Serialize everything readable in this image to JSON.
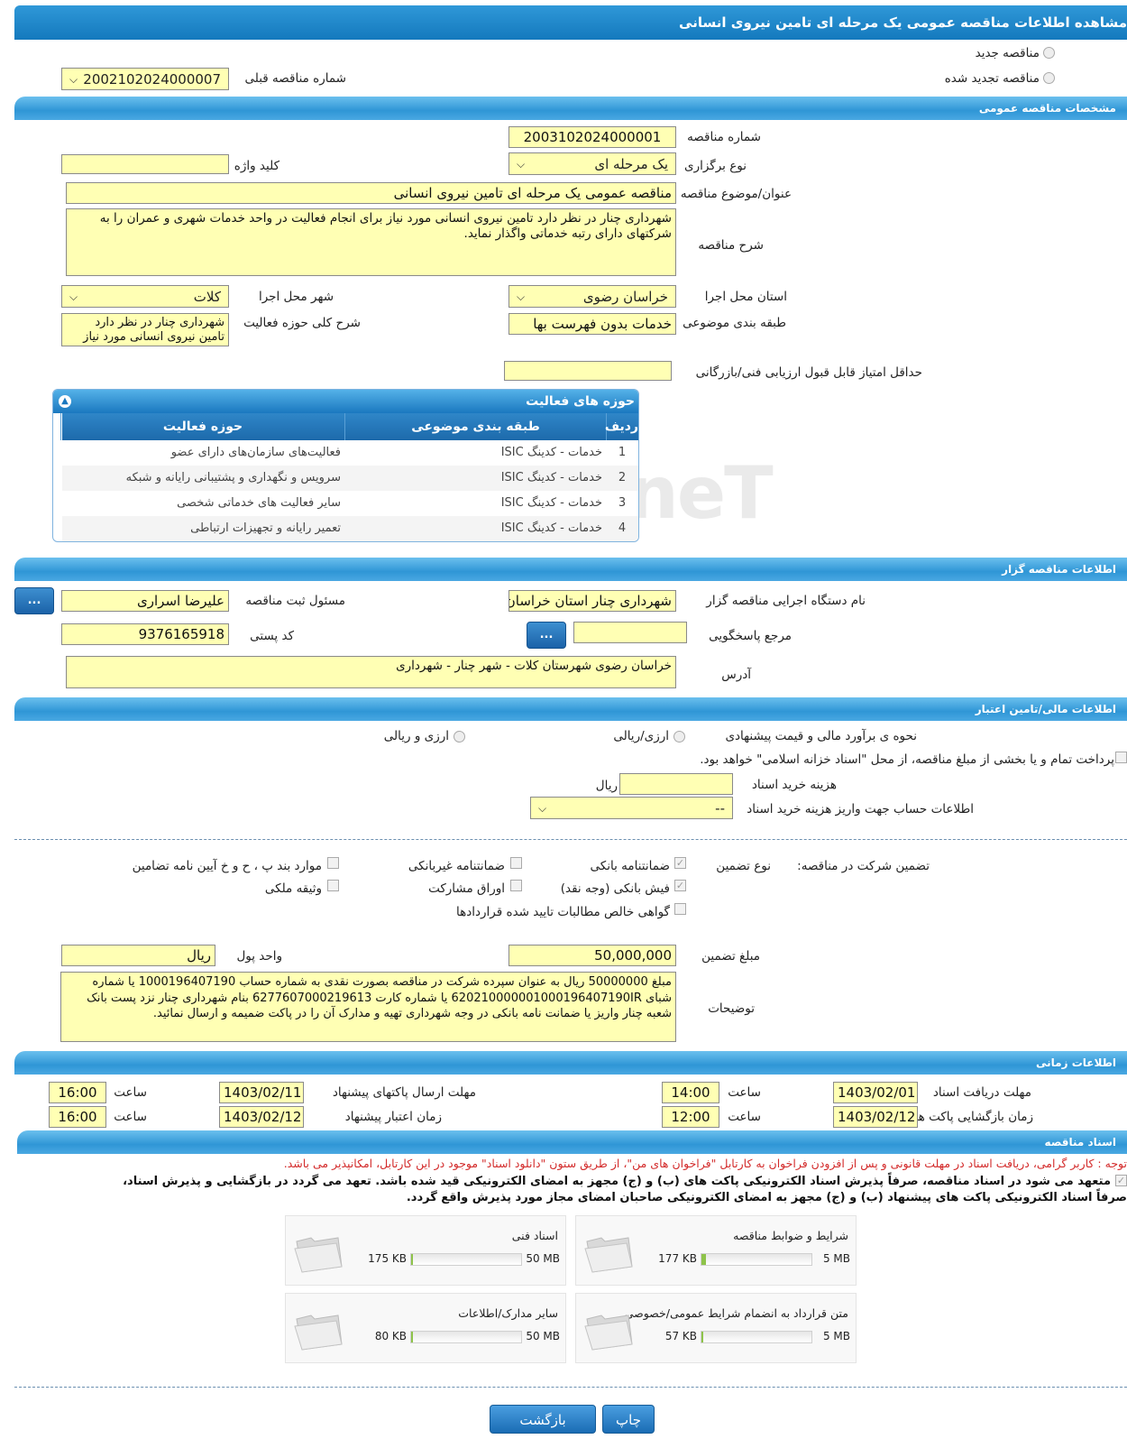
{
  "page_title": "مشاهده اطلاعات مناقصه عمومی یک مرحله ای تامین نیروی انسانی",
  "tender_type": {
    "new_label": "مناقصه جدید",
    "renewed_label": "مناقصه تجدید شده",
    "previous_number_label": "شماره مناقصه قبلی",
    "previous_number": "2002102024000007"
  },
  "general": {
    "header": "مشخصات مناقصه عمومی",
    "number_label": "شماره مناقصه",
    "number": "2003102024000001",
    "type_label": "نوع برگزاری",
    "type": "یک مرحله ای",
    "keyword_label": "کلید واژه",
    "keyword": "",
    "subject_label": "عنوان/موضوع مناقصه",
    "subject": "مناقصه عمومی یک مرحله ای تامین نیروی انسانی",
    "desc_label": "شرح مناقصه",
    "desc": "شهرداری چنار در نظر دارد تامین نیروی انسانی مورد نیاز برای انجام فعالیت در واحد خدمات شهری و عمران را به شرکتهای دارای رتبه خدماتی واگذار نماید.",
    "province_label": "استان محل اجرا",
    "province": "خراسان رضوی",
    "city_label": "شهر محل اجرا",
    "city": "کلات",
    "category_label": "طبقه بندی موضوعی",
    "category": "خدمات بدون فهرست بها",
    "scope_label": "شرح کلی حوزه فعالیت",
    "scope": "شهرداری چنار در نظر دارد تامین نیروی انسانی مورد نیاز",
    "min_score_label": "حداقل امتیاز قابل قبول ارزیابی فنی/بازرگانی",
    "min_score": ""
  },
  "activities": {
    "header": "حوزه های فعالیت",
    "columns": [
      "ردیف",
      "طبقه بندی موضوعی",
      "حوزه فعالیت"
    ],
    "rows": [
      [
        "1",
        "خدمات - کدینگ ISIC",
        "فعالیت‌های سازمان‌های دارای عضو"
      ],
      [
        "2",
        "خدمات - کدینگ ISIC",
        "سرویس و نگهداری و پشتیبانی رایانه و شبکه"
      ],
      [
        "3",
        "خدمات - کدینگ ISIC",
        "سایر فعالیت های خدماتی شخصی"
      ],
      [
        "4",
        "خدمات - کدینگ ISIC",
        "تعمیر رایانه و تجهیزات ارتباطی"
      ]
    ]
  },
  "organizer": {
    "header": "اطلاعات مناقصه گزار",
    "org_label": "نام دستگاه اجرایی مناقصه گزار",
    "org": "شهرداری چنار استان خراسان",
    "resp_label": "مسئول ثبت مناقصه",
    "resp": "علیرضا اسراری",
    "ref_label": "مرجع پاسخگویی",
    "ref": "",
    "postal_label": "کد پستی",
    "postal": "9376165918",
    "address_label": "آدرس",
    "address": "خراسان رضوی شهرستان کلات - شهر چنار - شهرداری",
    "dots": "..."
  },
  "finance": {
    "header": "اطلاعات مالی/تامین اعتبار",
    "estimate_label": "نحوه ی برآورد مالی و قیمت پیشنهادی",
    "opt1": "ارزی/ریالی",
    "opt2": "ارزی و ریالی",
    "treasury_label": "پرداخت تمام و یا بخشی از مبلغ مناقصه، از محل \"اسناد خزانه اسلامی\" خواهد بود.",
    "doc_cost_label": "هزینه خرید اسناد",
    "doc_cost": "",
    "rial": "ریال",
    "account_label": "اطلاعات حساب جهت واریز هزینه خرید اسناد",
    "account": "--"
  },
  "guarantee": {
    "label": "تضمین شرکت در مناقصه:",
    "type_label": "نوع تضمین",
    "opts": [
      "ضمانتنامه بانکی",
      "ضمانتنامه غیربانکی",
      "موارد بند پ ، ح و خ آیین نامه تضامین",
      "فیش بانکی (وجه نقد)",
      "اوراق مشارکت",
      "وثیقه ملکی",
      "گواهی خالص مطالبات تایید شده قراردادها"
    ],
    "amount_label": "مبلغ تضمین",
    "amount": "50,000,000",
    "currency_label": "واحد پول",
    "currency": "ریال",
    "notes_label": "توضیحات",
    "notes": "مبلغ 50000000 ریال به عنوان سپرده شرکت در مناقصه بصورت  نقدی به شماره حساب 1000196407190  یا شماره شبای 620210000001000196407190IR  یا شماره کارت 6277607000219613 بنام شهرداری چنار  نزد پست بانک شعبه چنار واریز یا ضمانت نامه بانکی در وجه شهرداری تهیه و مدارک آن را در پاکت ضمیمه و ارسال نمائید."
  },
  "timing": {
    "header": "اطلاعات زمانی",
    "doc_receive_label": "مهلت دریافت اسناد",
    "doc_receive": "1403/02/01",
    "doc_receive_time": "14:00",
    "send_label": "مهلت ارسال پاکتهای پیشنهاد",
    "send": "1403/02/11",
    "send_time": "16:00",
    "open_label": "زمان بازگشایی پاکت ها",
    "open": "1403/02/12",
    "open_time": "12:00",
    "valid_label": "زمان اعتبار پیشنهاد",
    "valid": "1403/02/12",
    "valid_time": "16:00",
    "time_label": "ساعت"
  },
  "docs": {
    "header": "اسناد مناقصه",
    "notice": "توجه : کاربر گرامی، دریافت اسناد در مهلت قانونی و پس از افزودن فراخوان به کارتابل \"فراخوان های من\"، از طریق ستون \"دانلود اسناد\" موجود در این کارتابل، امکانپذیر می باشد.",
    "commit1": "متعهد می شود در اسناد مناقصه، صرفاً پذیرش اسناد الکترونیکی پاکت های (ب) و (ج) مجهز به امضای الکترونیکی قید شده باشد. تعهد می گردد در بازگشایی و پذیرش اسناد،",
    "commit2": "صرفاً اسناد الکترونیکی پاکت های پیشنهاد (ب) و (ج) مجهز به امضای الکترونیکی صاحبان امضای مجاز مورد پذیرش واقع گردد.",
    "files": [
      {
        "title": "شرایط و ضوابط مناقصه",
        "size": "177 KB",
        "max": "5 MB",
        "fill": 0.04
      },
      {
        "title": "اسناد فنی",
        "size": "175 KB",
        "max": "50 MB",
        "fill": 0.01
      },
      {
        "title": "متن قرارداد به انضمام شرایط عمومی/خصوصی",
        "size": "57 KB",
        "max": "5 MB",
        "fill": 0.015
      },
      {
        "title": "سایر مدارک/اطلاعات",
        "size": "80 KB",
        "max": "50 MB",
        "fill": 0.005
      }
    ]
  },
  "buttons": {
    "print": "چاپ",
    "back": "بازگشت"
  },
  "watermark": "AriaTender.neT"
}
